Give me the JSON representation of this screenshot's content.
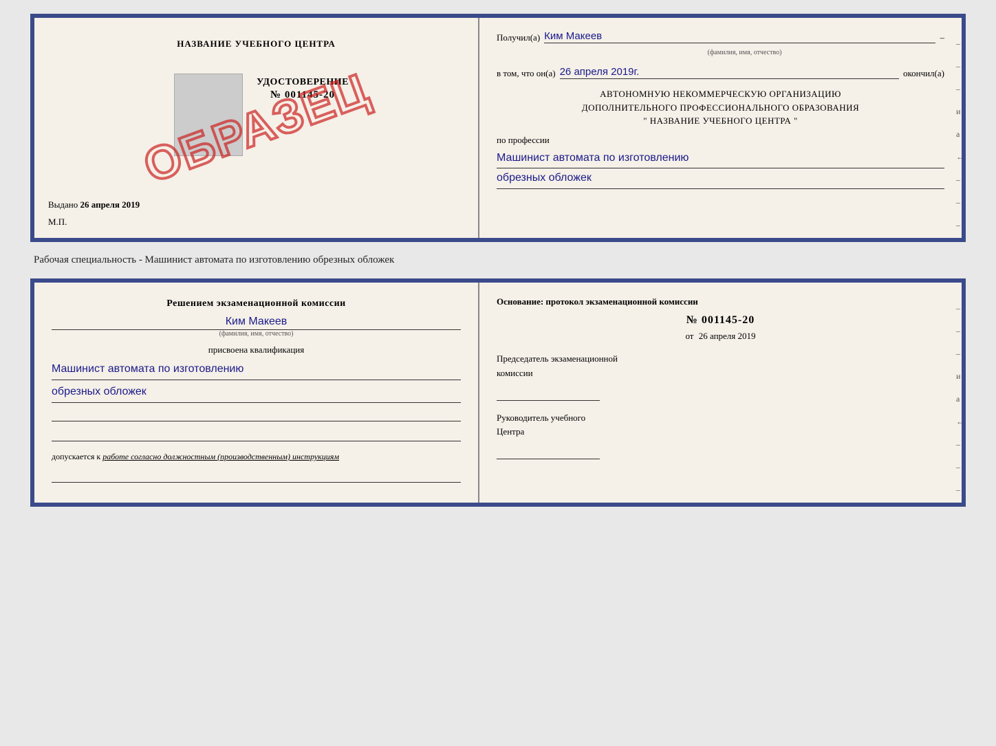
{
  "top_doc": {
    "left": {
      "school_name": "НАЗВАНИЕ УЧЕБНОГО ЦЕНТРА",
      "stamp_text": "ОБРАЗЕЦ",
      "udostoverenie_label": "УДОСТОВЕРЕНИЕ",
      "number": "№ 001145-20",
      "vydano_label": "Выдано",
      "vydano_date": "26 апреля 2019",
      "mp_label": "М.П."
    },
    "right": {
      "poluchil_label": "Получил(а)",
      "person_name": "Ким Макеев",
      "fio_sub": "(фамилия, имя, отчество)",
      "v_tom_chto_label": "в том, что он(а)",
      "date_value": "26 апреля 2019г.",
      "okonchil_label": "окончил(а)",
      "org_line1": "АВТОНОМНУЮ НЕКОММЕРЧЕСКУЮ ОРГАНИЗАЦИЮ",
      "org_line2": "ДОПОЛНИТЕЛЬНОГО ПРОФЕССИОНАЛЬНОГО ОБРАЗОВАНИЯ",
      "org_line3": "\"  НАЗВАНИЕ УЧЕБНОГО ЦЕНТРА  \"",
      "po_professii_label": "по профессии",
      "profession_line1": "Машинист автомата по изготовлению",
      "profession_line2": "обрезных обложек",
      "side_dashes": [
        "–",
        "–",
        "–",
        "и",
        "а",
        "←",
        "–",
        "–",
        "–",
        "–"
      ]
    }
  },
  "specialty_label": "Рабочая специальность - Машинист автомата по изготовлению обрезных обложек",
  "bottom_doc": {
    "left": {
      "resheniem_line1": "Решением экзаменационной комиссии",
      "person_name": "Ким Макеев",
      "fio_sub": "(фамилия, имя, отчество)",
      "prisvoena_label": "присвоена квалификация",
      "qualification_line1": "Машинист автомата по изготовлению",
      "qualification_line2": "обрезных обложек",
      "dopuskaetsya_prefix": "допускается к",
      "dopuskaetsya_italic": "работе согласно должностным (производственным) инструкциям"
    },
    "right": {
      "osnovanie_label": "Основание: протокол экзаменационной комиссии",
      "protocol_number": "№  001145-20",
      "ot_label": "от",
      "ot_date": "26 апреля 2019",
      "predsedatel_line1": "Председатель экзаменационной",
      "predsedatel_line2": "комиссии",
      "rukovoditel_line1": "Руководитель учебного",
      "rukovoditel_line2": "Центра",
      "side_dashes": [
        "–",
        "–",
        "–",
        "и",
        "а",
        "←",
        "–",
        "–",
        "–",
        "–"
      ]
    }
  }
}
